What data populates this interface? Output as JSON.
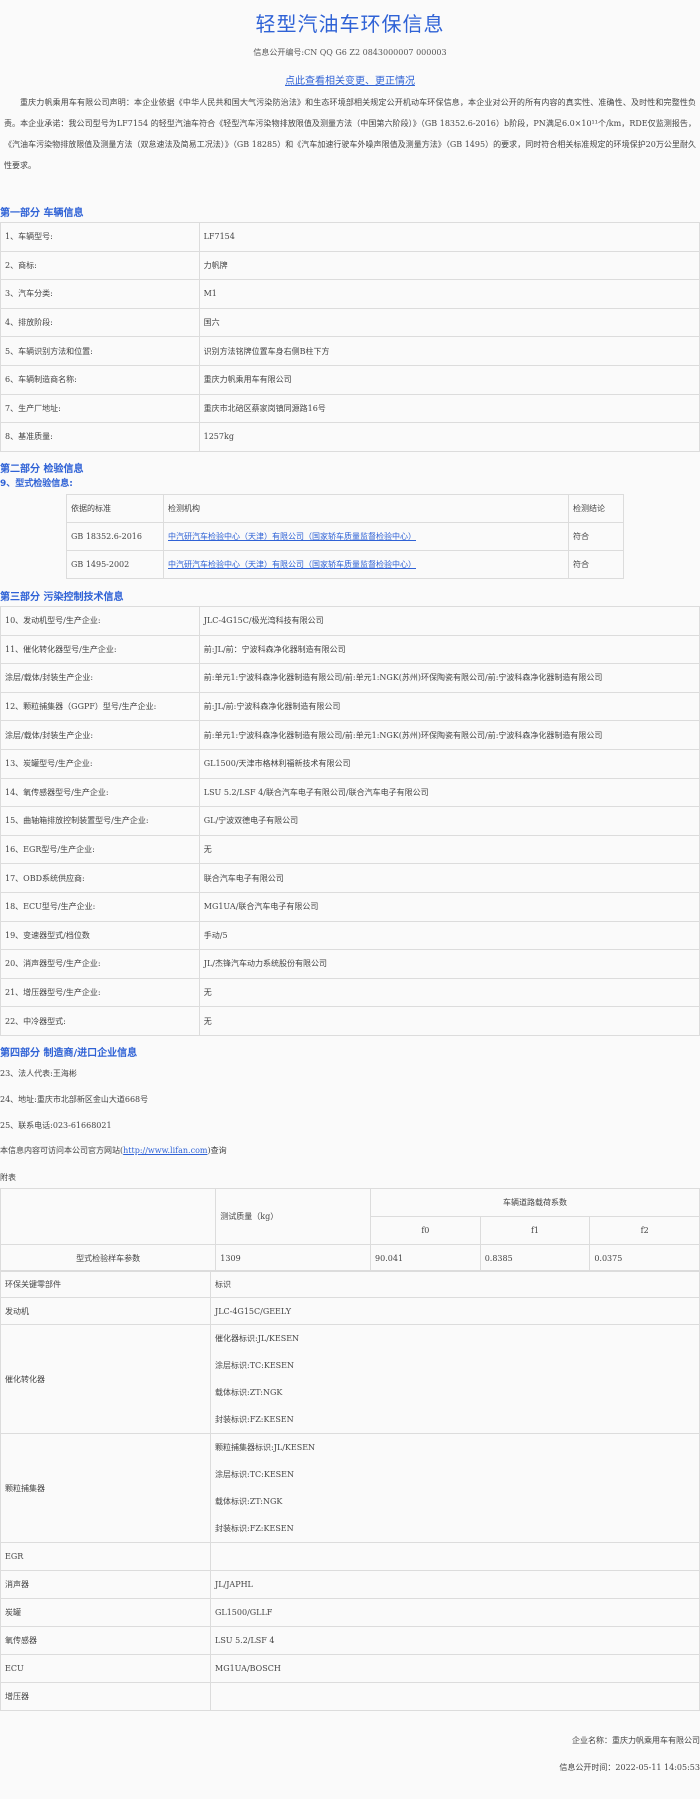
{
  "header": {
    "title": "轻型汽油车环保信息",
    "info_code": "信息公开编号:CN QQ G6 Z2 0843000007 000003",
    "change_link": "点此查看相关变更、更正情况"
  },
  "declaration": "重庆力帆乘用车有限公司声明：本企业依据《中华人民共和国大气污染防治法》和生态环境部相关规定公开机动车环保信息，本企业对公开的所有内容的真实性、准确性、及时性和完整性负责。本企业承诺：我公司型号为LF7154 的轻型汽油车符合《轻型汽车污染物排放限值及测量方法（中国第六阶段）》（GB 18352.6-2016）b阶段，PN满足6.0×10¹¹个/km，RDE仅监测报告，《汽油车污染物排放限值及测量方法（双怠速法及简易工况法）》（GB 18285）和《汽车加速行驶车外噪声限值及测量方法》（GB 1495）的要求，同时符合相关标准规定的环境保护20万公里耐久性要求。",
  "part1": {
    "heading": "第一部分 车辆信息",
    "rows": [
      {
        "k": "1、车辆型号:",
        "v": "LF7154"
      },
      {
        "k": "2、商标:",
        "v": "力帆牌"
      },
      {
        "k": "3、汽车分类:",
        "v": "M1"
      },
      {
        "k": "4、排放阶段:",
        "v": "国六"
      },
      {
        "k": "5、车辆识别方法和位置:",
        "v": "识别方法铭牌位置车身右侧B柱下方"
      },
      {
        "k": "6、车辆制造商名称:",
        "v": "重庆力帆乘用车有限公司"
      },
      {
        "k": "7、生产厂地址:",
        "v": "重庆市北碚区蔡家岗镇同源路16号"
      },
      {
        "k": "8、基准质量:",
        "v": "1257kg"
      }
    ]
  },
  "part2": {
    "heading": "第二部分 检验信息",
    "subheading": "9、型式检验信息:",
    "columns": [
      "依据的标准",
      "检测机构",
      "检测结论"
    ],
    "rows": [
      {
        "std": "GB 18352.6-2016",
        "org": "中汽研汽车检验中心（天津）有限公司（国家轿车质量监督检验中心）",
        "res": "符合"
      },
      {
        "std": "GB 1495-2002",
        "org": "中汽研汽车检验中心（天津）有限公司（国家轿车质量监督检验中心）",
        "res": "符合"
      }
    ]
  },
  "part3": {
    "heading": "第三部分 污染控制技术信息",
    "rows": [
      {
        "k": "10、发动机型号/生产企业:",
        "v": "JLC-4G15C/极光湾科技有限公司"
      },
      {
        "k": "11、催化转化器型号/生产企业:",
        "v": "前:JL/前：宁波科森净化器制造有限公司"
      },
      {
        "k": "涂层/载体/封装生产企业:",
        "v": "前:单元1:宁波科森净化器制造有限公司/前:单元1:NGK(苏州)环保陶瓷有限公司/前:宁波科森净化器制造有限公司"
      },
      {
        "k": "12、颗粒捕集器（GGPF）型号/生产企业:",
        "v": "前:JL/前:宁波科森净化器制造有限公司"
      },
      {
        "k": "涂层/载体/封装生产企业:",
        "v": "前:单元1:宁波科森净化器制造有限公司/前:单元1:NGK(苏州)环保陶瓷有限公司/前:宁波科森净化器制造有限公司"
      },
      {
        "k": "13、炭罐型号/生产企业:",
        "v": "GL1500/天津市格林利福新技术有限公司"
      },
      {
        "k": "14、氧传感器型号/生产企业:",
        "v": "LSU 5.2/LSF 4/联合汽车电子有限公司/联合汽车电子有限公司"
      },
      {
        "k": "15、曲轴箱排放控制装置型号/生产企业:",
        "v": "GL/宁波双德电子有限公司"
      },
      {
        "k": "16、EGR型号/生产企业:",
        "v": "无"
      },
      {
        "k": "17、OBD系统供应商:",
        "v": "联合汽车电子有限公司"
      },
      {
        "k": "18、ECU型号/生产企业:",
        "v": "MG1UA/联合汽车电子有限公司"
      },
      {
        "k": "19、变速器型式/档位数",
        "v": "手动/5"
      },
      {
        "k": "20、消声器型号/生产企业:",
        "v": "JL/杰锋汽车动力系统股份有限公司"
      },
      {
        "k": "21、增压器型号/生产企业:",
        "v": "无"
      },
      {
        "k": "22、中冷器型式:",
        "v": "无"
      }
    ]
  },
  "part4": {
    "heading": "第四部分 制造商/进口企业信息",
    "legal_rep": "23、法人代表:王海彬",
    "address": "24、地址:重庆市北部新区金山大道668号",
    "phone": "25、联系电话:023-61668021",
    "website_prefix": "本信息内容可访问本公司官方网站(",
    "website": "http://www.lifan.com",
    "website_suffix": ")查询"
  },
  "annex": {
    "label": "附表",
    "mass_header": "测试质量（kg）",
    "coef_header": "车辆道路载荷系数",
    "f0": "f0",
    "f1": "f1",
    "f2": "f2",
    "param_label": "型式检验样车参数",
    "mass": "1309",
    "f0_val": "90.041",
    "f1_val": "0.8385",
    "f2_val": "0.0375",
    "key_parts_label": "环保关键零部件",
    "key_parts_value": "标识",
    "engine_label": "发动机",
    "engine_value": "JLC-4G15C/GEELY",
    "catalyst_label": "催化转化器",
    "catalyst_lines": [
      "催化器标识:JL/KESEN",
      "涂层标识:TC:KESEN",
      "载体标识:ZT:NGK",
      "封装标识:FZ:KESEN"
    ],
    "gpf_label": "颗粒捕集器",
    "gpf_lines": [
      "颗粒捕集器标识:JL/KESEN",
      "涂层标识:TC:KESEN",
      "载体标识:ZT:NGK",
      "封装标识:FZ:KESEN"
    ],
    "egr_label": "EGR",
    "egr_value": "",
    "muffler_label": "消声器",
    "muffler_value": "JL/JAPHL",
    "canister_label": "炭罐",
    "canister_value": "GL1500/GLLF",
    "o2_label": "氧传感器",
    "o2_value": "LSU 5.2/LSF 4",
    "ecu_label": "ECU",
    "ecu_value": "MG1UA/BOSCH",
    "turbo_label": "增压器",
    "turbo_value": ""
  },
  "footer": {
    "company": "企业名称：重庆力帆乘用车有限公司",
    "date": "信息公开时间：2022-05-11 14:05:53"
  }
}
